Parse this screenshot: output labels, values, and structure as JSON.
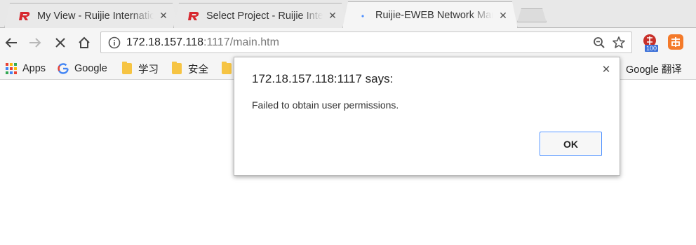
{
  "tabs": [
    {
      "title": "My View - Ruijie International"
    },
    {
      "title": "Select Project - Ruijie International"
    },
    {
      "title": "Ruijie-EWEB Network Management"
    }
  ],
  "address_bar": {
    "host": "172.18.157.118",
    "rest": ":1117/main.htm"
  },
  "extensions": {
    "badge_count": "100"
  },
  "bookmarks": {
    "apps": "Apps",
    "google": "Google",
    "folder_study": "学习",
    "folder_security": "安全",
    "google_translate": "Google 翻译"
  },
  "dialog": {
    "title": "172.18.157.118:1117 says:",
    "message": "Failed to obtain user permissions.",
    "ok_label": "OK"
  },
  "colors": {
    "accent_blue": "#4d90fe",
    "ruijie_red": "#d7282f"
  }
}
